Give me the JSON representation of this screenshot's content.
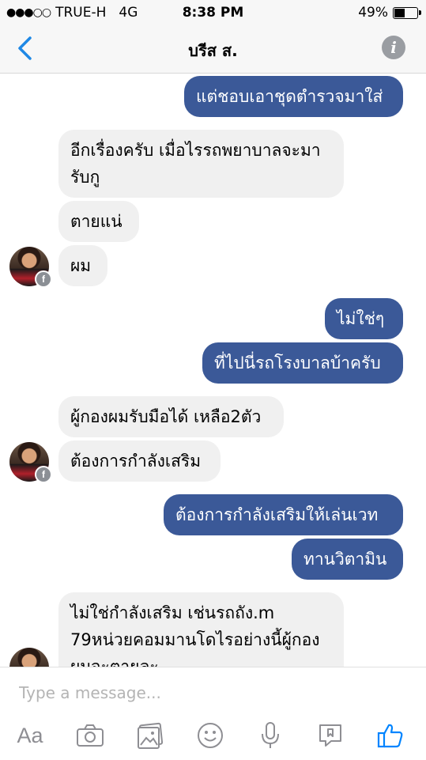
{
  "status_bar": {
    "carrier": "TRUE-H",
    "network": "4G",
    "time": "8:38 PM",
    "battery_percent": "49%",
    "battery_level": 0.49,
    "signal_dots": "●●●○○"
  },
  "nav": {
    "title": "บรีส ส.",
    "back_icon": "chevron-left-icon",
    "info_icon": "info-icon",
    "info_glyph": "i"
  },
  "messages": [
    {
      "side": "out",
      "text": "แต่ชอบเอาชุดตำรวจมาใส่"
    },
    {
      "side": "in",
      "text": "อีกเรื่องครับ เมื่อไรรถพยาบาลจะมา\nรับกู"
    },
    {
      "side": "in",
      "text": "ตายแน่"
    },
    {
      "side": "in",
      "text": "ผม"
    },
    {
      "side": "out",
      "text": "ไม่ใช่ๆ"
    },
    {
      "side": "out",
      "text": "ที่ไปนี่รถโรงบาลบ้าครับ"
    },
    {
      "side": "in",
      "text": "ผู้กองผมรับมือได้ เหลือ2ตัว"
    },
    {
      "side": "in",
      "text": "ต้องการกำลังเสริม"
    },
    {
      "side": "out",
      "text": "ต้องการกำลังเสริมให้เล่นเวท"
    },
    {
      "side": "out",
      "text": "ทานวิตามิน"
    },
    {
      "side": "in",
      "text": "ไม่ใช่กำลังเสริม เช่นรถถัง.m\n79หน่วยคอมมานโดไรอย่างนี้ผู้กอง\nผมจะตายละ"
    }
  ],
  "avatar": {
    "badge": "f"
  },
  "composer": {
    "placeholder": "Type a message...",
    "tools": [
      {
        "name": "text-format-icon",
        "label": "Aa"
      },
      {
        "name": "camera-icon"
      },
      {
        "name": "photo-gallery-icon"
      },
      {
        "name": "emoji-icon"
      },
      {
        "name": "microphone-icon"
      },
      {
        "name": "sticker-icon"
      },
      {
        "name": "like-icon"
      }
    ]
  },
  "colors": {
    "outgoing": "#3b5998",
    "incoming": "#f0f0f0",
    "accent": "#0084ff",
    "icon_gray": "#8e8e93"
  }
}
